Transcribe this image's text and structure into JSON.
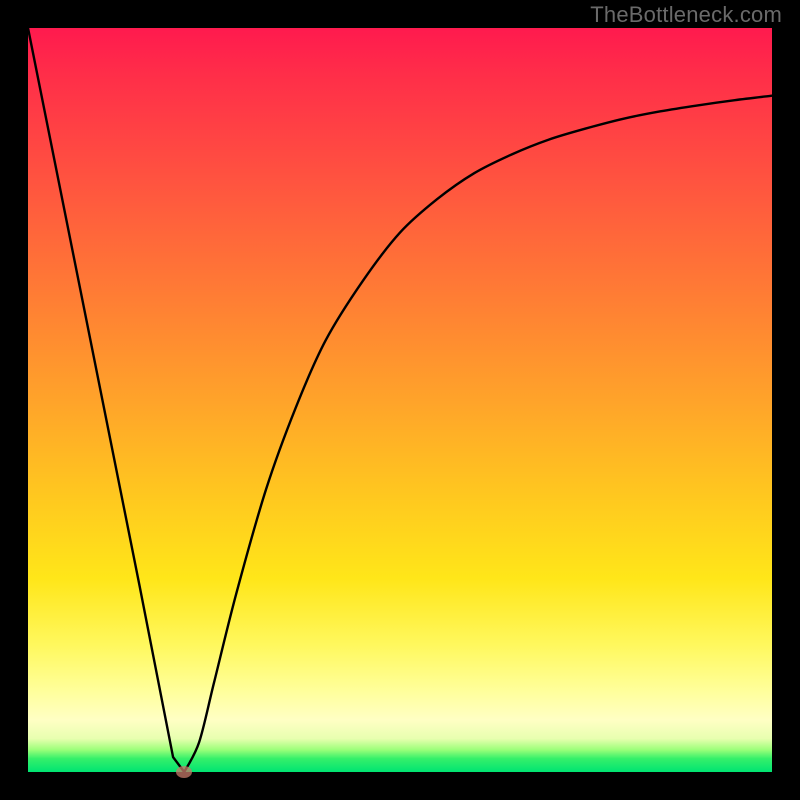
{
  "watermark": "TheBottleneck.com",
  "chart_data": {
    "type": "line",
    "title": "",
    "xlabel": "",
    "ylabel": "",
    "xlim": [
      0,
      100
    ],
    "ylim": [
      0,
      100
    ],
    "grid": false,
    "legend": false,
    "series": [
      {
        "name": "bottleneck-curve",
        "x": [
          0,
          5,
          10,
          15,
          19.5,
          21,
          23,
          25,
          28,
          32,
          36,
          40,
          45,
          50,
          55,
          60,
          65,
          70,
          75,
          80,
          85,
          90,
          95,
          100
        ],
        "values": [
          100,
          75,
          50,
          25,
          2,
          0,
          4,
          12,
          24,
          38,
          49,
          58,
          66,
          72.5,
          77,
          80.5,
          83,
          85,
          86.5,
          87.8,
          88.8,
          89.6,
          90.3,
          90.9
        ]
      }
    ],
    "marker": {
      "x": 21,
      "y": 0
    },
    "annotations": [],
    "colors": {
      "curve": "#000000",
      "marker": "#c77a6a",
      "gradient_top": "#ff1a4e",
      "gradient_bottom": "#00e472"
    }
  }
}
